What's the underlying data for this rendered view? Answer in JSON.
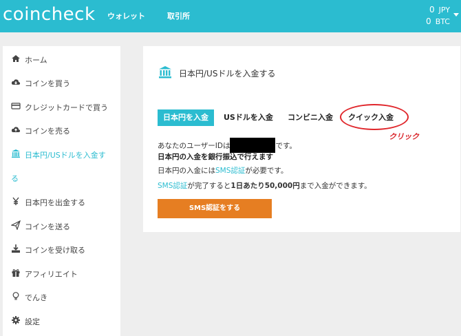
{
  "header": {
    "logo": "coincheck",
    "nav": [
      "ウォレット",
      "取引所"
    ],
    "balances": [
      {
        "amount": "0",
        "currency": "JPY"
      },
      {
        "amount": "0",
        "currency": "BTC"
      }
    ]
  },
  "sidebar": {
    "items": [
      {
        "label": "ホーム",
        "icon": "home-icon"
      },
      {
        "label": "コインを買う",
        "icon": "cloud-download-icon"
      },
      {
        "label": "クレジットカードで買う",
        "icon": "credit-card-icon"
      },
      {
        "label": "コインを売る",
        "icon": "cloud-upload-icon"
      },
      {
        "label": "日本円/USドルを入金す",
        "icon": "bank-icon"
      },
      {
        "label": "日本円を出金する",
        "icon": "yen-icon"
      },
      {
        "label": "コインを送る",
        "icon": "send-icon"
      },
      {
        "label": "コインを受け取る",
        "icon": "download-icon"
      },
      {
        "label": "アフィリエイト",
        "icon": "gift-icon"
      },
      {
        "label": "でんき",
        "icon": "lightbulb-icon"
      },
      {
        "label": "設定",
        "icon": "gear-icon"
      }
    ],
    "active_continuation": "る"
  },
  "main": {
    "title": "日本円/USドルを入金する",
    "tabs": [
      "日本円を入金",
      "USドルを入金",
      "コンビニ入金",
      "クイック入金"
    ],
    "user_id_prefix": "あなたのユーザーIDは",
    "user_id_suffix": "です。",
    "notice_bold": "日本円の入金を銀行振込で行えます",
    "sms_line_prefix": "日本円の入金には",
    "sms_link": "SMS認証",
    "sms_line_suffix": "が必要です。",
    "limit_line_link": "SMS認証",
    "limit_line_mid": "が完了すると",
    "limit_line_bold": "1日あたり50,000円",
    "limit_line_suffix": "まで入金ができます。",
    "sms_button": "SMS認証をする"
  },
  "annotation": {
    "text": "クリック",
    "color": "#e0262b"
  },
  "colors": {
    "accent": "#2bbcd0",
    "button": "#e67e22"
  }
}
